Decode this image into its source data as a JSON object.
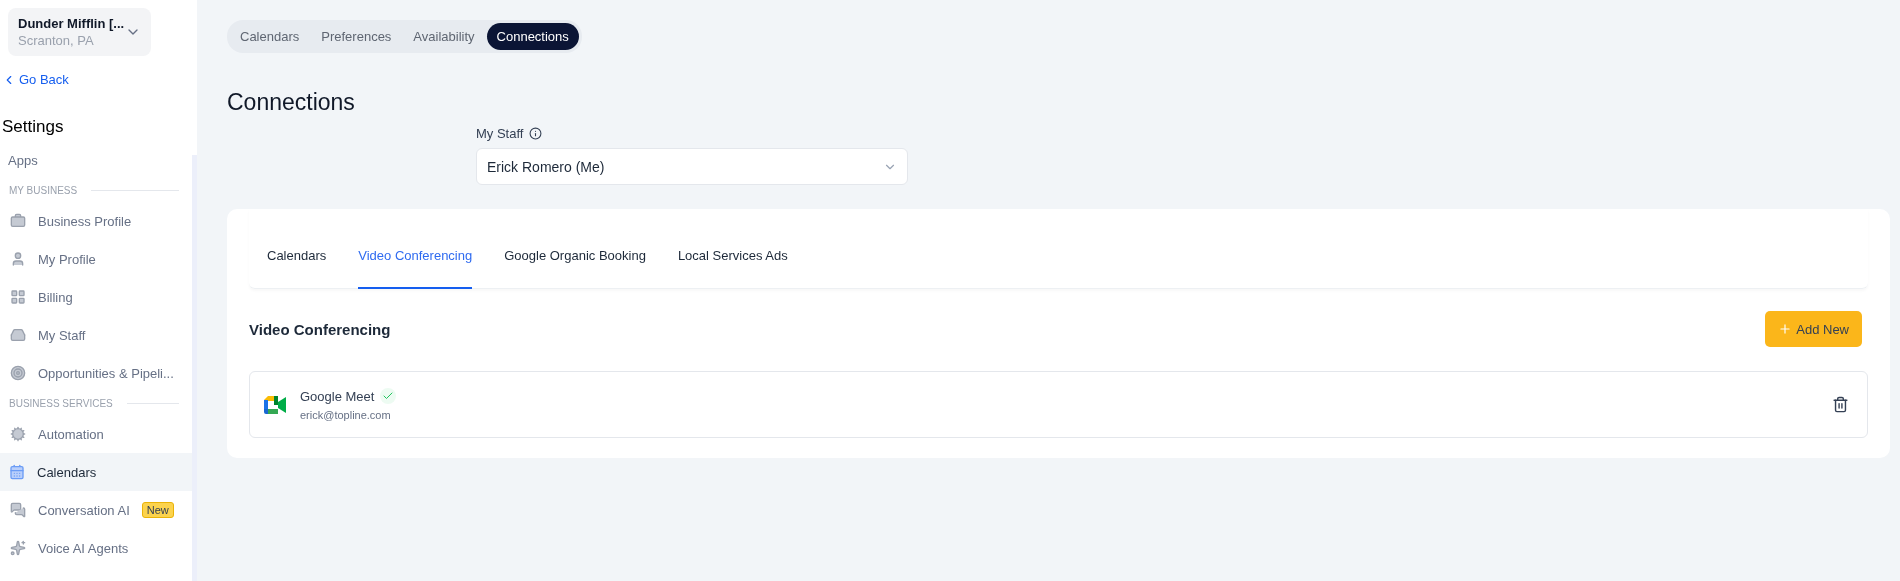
{
  "account": {
    "name": "Dunder Mifflin [...",
    "location": "Scranton, PA"
  },
  "back_link": "Go Back",
  "sidebar": {
    "title": "Settings",
    "top_items": [
      {
        "label": "Apps",
        "selected": false
      }
    ],
    "sections": [
      {
        "heading": "MY BUSINESS",
        "items": [
          {
            "label": "Business Profile",
            "selected": false
          },
          {
            "label": "My Profile",
            "selected": false
          },
          {
            "label": "Billing",
            "selected": false
          },
          {
            "label": "My Staff",
            "selected": false
          },
          {
            "label": "Opportunities & Pipeli...",
            "selected": false
          }
        ]
      },
      {
        "heading": "BUSINESS SERVICES",
        "items": [
          {
            "label": "Automation",
            "selected": false
          },
          {
            "label": "Calendars",
            "selected": true
          },
          {
            "label": "Conversation AI",
            "selected": false,
            "badge": "New"
          },
          {
            "label": "Voice AI Agents",
            "selected": false
          }
        ]
      }
    ]
  },
  "top_tabs": [
    {
      "label": "Calendars",
      "selected": false
    },
    {
      "label": "Preferences",
      "selected": false
    },
    {
      "label": "Availability",
      "selected": false
    },
    {
      "label": "Connections",
      "selected": true
    }
  ],
  "page_title": "Connections",
  "staff_select": {
    "label": "My Staff",
    "value": "Erick Romero (Me)"
  },
  "card_tabs": [
    {
      "label": "Calendars",
      "selected": false
    },
    {
      "label": "Video Conferencing",
      "selected": true
    },
    {
      "label": "Google Organic Booking",
      "selected": false
    },
    {
      "label": "Local Services Ads",
      "selected": false
    }
  ],
  "section": {
    "title": "Video Conferencing",
    "add_button": "Add New"
  },
  "connections": [
    {
      "name": "Google Meet",
      "email": "erick@topline.com",
      "connected": true
    }
  ]
}
